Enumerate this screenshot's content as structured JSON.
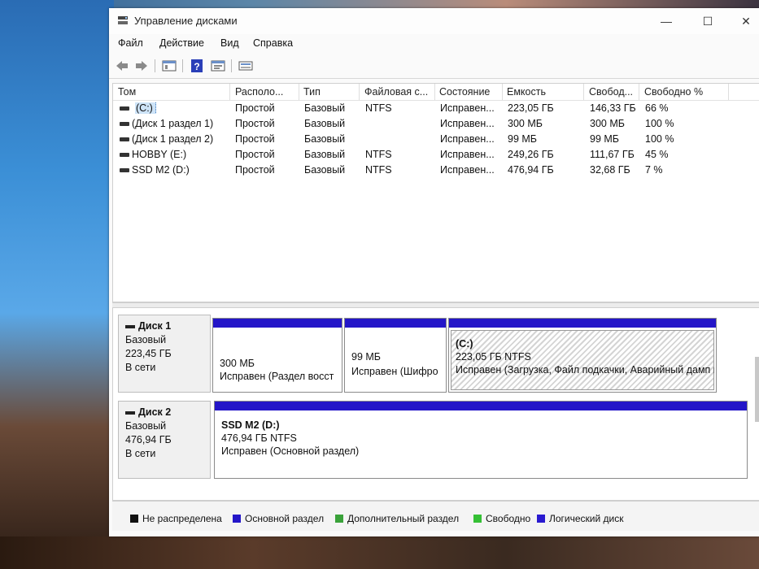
{
  "window": {
    "title": "Управление дисками",
    "minimize": "—",
    "maximize": "☐",
    "close": "✕"
  },
  "menu": [
    "Файл",
    "Действие",
    "Вид",
    "Справка"
  ],
  "table": {
    "columns": [
      "Том",
      "Располо...",
      "Тип",
      "Файловая с...",
      "Состояние",
      "Емкость",
      "Свобод...",
      "Свободно %"
    ],
    "rows": [
      [
        "(C:)",
        "Простой",
        "Базовый",
        "NTFS",
        "Исправен...",
        "223,05 ГБ",
        "146,33 ГБ",
        "66 %"
      ],
      [
        "(Диск 1 раздел 1)",
        "Простой",
        "Базовый",
        "",
        "Исправен...",
        "300 МБ",
        "300 МБ",
        "100 %"
      ],
      [
        "(Диск 1 раздел 2)",
        "Простой",
        "Базовый",
        "",
        "Исправен...",
        "99 МБ",
        "99 МБ",
        "100 %"
      ],
      [
        "HOBBY (E:)",
        "Простой",
        "Базовый",
        "NTFS",
        "Исправен...",
        "249,26 ГБ",
        "111,67 ГБ",
        "45 %"
      ],
      [
        "SSD M2 (D:)",
        "Простой",
        "Базовый",
        "NTFS",
        "Исправен...",
        "476,94 ГБ",
        "32,68 ГБ",
        "7 %"
      ]
    ]
  },
  "disks": [
    {
      "name": "Диск 1",
      "type": "Базовый",
      "size": "223,45 ГБ",
      "status": "В сети",
      "partitions": [
        {
          "label": "",
          "size": "300 МБ",
          "status": "Исправен (Раздел восст"
        },
        {
          "label": "",
          "size": "99 МБ",
          "status": "Исправен (Шифро"
        },
        {
          "label": "(C:)",
          "size": "223,05 ГБ NTFS",
          "status": "Исправен (Загрузка, Файл подкачки, Аварийный дамп г"
        }
      ]
    },
    {
      "name": "Диск 2",
      "type": "Базовый",
      "size": "476,94 ГБ",
      "status": "В сети",
      "partitions": [
        {
          "label": "SSD M2  (D:)",
          "size": "476,94 ГБ NTFS",
          "status": "Исправен (Основной раздел)"
        }
      ]
    }
  ],
  "legend": [
    {
      "label": "Не распределена",
      "color": "#111111"
    },
    {
      "label": "Основной раздел",
      "color": "#2416c8"
    },
    {
      "label": "Дополнительный раздел",
      "color": "#3aa23a"
    },
    {
      "label": "Свободно",
      "color": "#35c035"
    },
    {
      "label": "Логический диск",
      "color": "#2a1ad0"
    }
  ],
  "colors": {
    "primary_partition": "#2416c8",
    "selection": "#cde3f7"
  }
}
